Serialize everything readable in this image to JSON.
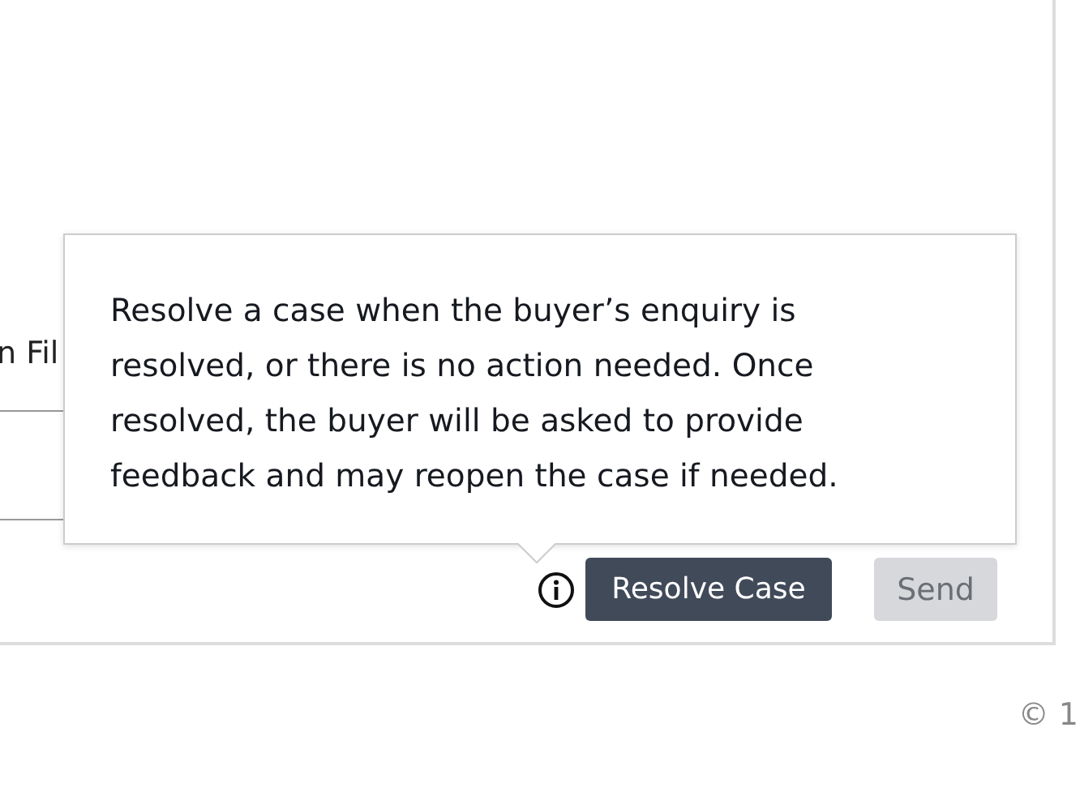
{
  "form": {
    "field_label": "n Fil"
  },
  "tooltip": {
    "text": "Resolve a case when the buyer’s enquiry is resolved, or there is no action needed. Once resolved, the buyer will be asked to provide feedback and may reopen the case if needed."
  },
  "actions": [
    {
      "kind": "info"
    },
    {
      "kind": "button",
      "label": "Resolve Case",
      "disabled": false
    },
    {
      "kind": "button",
      "label": "Send",
      "disabled": true
    }
  ],
  "footer": {
    "text": "© 1"
  }
}
